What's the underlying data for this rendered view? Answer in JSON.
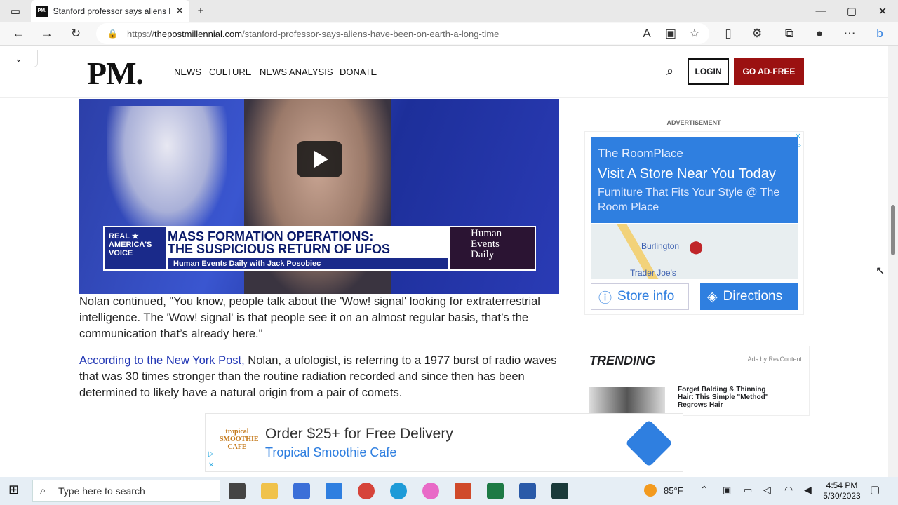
{
  "browser": {
    "tab_title": "Stanford professor says aliens ha",
    "tab_favicon": "PM.",
    "url_domain": "thepostmillennial.com",
    "url_prefix": "https://",
    "url_path": "/stanford-professor-says-aliens-have-been-on-earth-a-long-time"
  },
  "site": {
    "logo": "PM.",
    "nav": [
      "NEWS",
      "CULTURE",
      "NEWS ANALYSIS",
      "DONATE"
    ],
    "login": "LOGIN",
    "adfree": "GO AD-FREE"
  },
  "video": {
    "network": "REAL ★ AMERICA'S VOICE",
    "headline_1": "MASS FORMATION OPERATIONS:",
    "headline_2": "THE SUSPICIOUS RETURN OF UFOS",
    "subline": "Human Events Daily with Jack Posobiec",
    "show": "Human Events Daily"
  },
  "article": {
    "p1": "Nolan continued, \"You know, people talk about the 'Wow! signal' looking for extraterrestrial intelligence. The 'Wow! signal' is that people see it on an almost regular basis, that’s the communication that’s already here.\"",
    "p2_link": "According to the New York Post,",
    "p2_rest": " Nolan, a ufologist, is referring to a 1977 burst of radio waves that was 30 times stronger than the routine radiation recorded and since then has been determined to likely have a natural origin from a pair of comets."
  },
  "sidebar_ad": {
    "label": "ADVERTISEMENT",
    "brand": "The RoomPlace",
    "headline": "Visit A Store Near You Today",
    "sub": "Furniture That Fits Your Style @ The Room Place",
    "map_city": "Burlington",
    "map_store": "Trader Joe's",
    "store_btn": "Store info",
    "dir_btn": "Directions"
  },
  "trending": {
    "title": "TRENDING",
    "by": "Ads by RevContent",
    "item": "Forget Balding & Thinning Hair: This Simple \"Method\" Regrows Hair"
  },
  "bottom_ad": {
    "logo": "tropical SMOOTHIE CAFE",
    "headline": "Order $25+ for Free Delivery",
    "sub": "Tropical Smoothie Cafe"
  },
  "taskbar": {
    "search_placeholder": "Type here to search",
    "weather": "85°F",
    "time": "4:54 PM",
    "date": "5/30/2023"
  }
}
